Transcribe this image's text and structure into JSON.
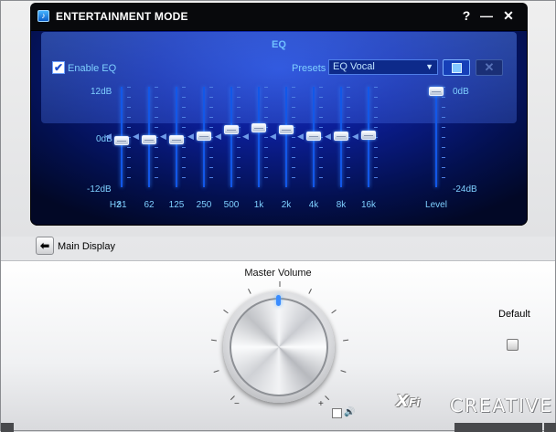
{
  "window": {
    "title": "ENTERTAINMENT MODE",
    "help_label": "?",
    "minimize_label": "—",
    "close_label": "✕"
  },
  "eq": {
    "title": "EQ",
    "enable_label": "Enable EQ",
    "enabled": true,
    "presets_label": "Presets",
    "preset_value": "EQ Vocal",
    "db_top": "12dB",
    "db_mid": "0dB",
    "db_bottom": "-12dB",
    "hz_prefix": "Hz",
    "bands": [
      {
        "freq": "31",
        "gain_db": -1
      },
      {
        "freq": "62",
        "gain_db": -0.6
      },
      {
        "freq": "125",
        "gain_db": -0.6
      },
      {
        "freq": "250",
        "gain_db": 0.2
      },
      {
        "freq": "500",
        "gain_db": 2
      },
      {
        "freq": "1k",
        "gain_db": 2.5
      },
      {
        "freq": "2k",
        "gain_db": 2
      },
      {
        "freq": "4k",
        "gain_db": 0.2
      },
      {
        "freq": "8k",
        "gain_db": 0.2
      },
      {
        "freq": "16k",
        "gain_db": 0.5
      }
    ],
    "level_label": "Level",
    "level_top": "0dB",
    "level_bottom": "-24dB",
    "level_value_db": 0
  },
  "main_display_label": "Main Display",
  "master_volume_label": "Master Volume",
  "default_label": "Default",
  "brand": {
    "xfi": "X-Fi",
    "creative": "CREATIVE"
  },
  "icons": {
    "app": "app-icon",
    "back": "arrow-left-icon",
    "save": "save-icon",
    "delete": "close-icon",
    "speaker": "speaker-icon"
  },
  "colors": {
    "screen_blue": "#0c1f9a",
    "label_cyan": "#7fd0ff",
    "title_bar": "#08090c"
  }
}
